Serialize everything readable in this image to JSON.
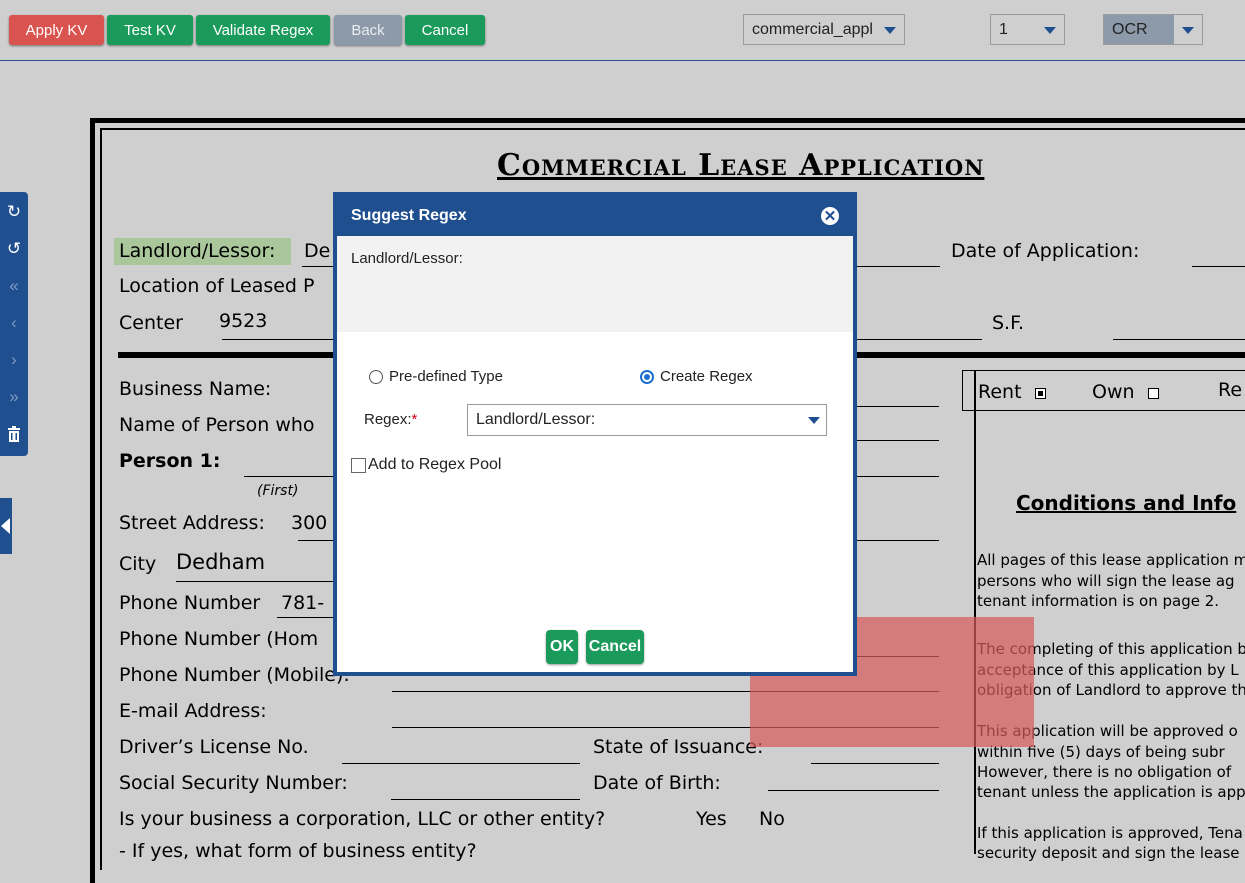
{
  "toolbar": {
    "apply_kv": "Apply KV",
    "test_kv": "Test KV",
    "validate_regex": "Validate Regex",
    "back": "Back",
    "cancel": "Cancel",
    "doc_type_select": "commercial_appl",
    "page_select": "1",
    "mode_select": "OCR"
  },
  "document": {
    "title": "Commercial Lease Application",
    "landlord_label": "Landlord/Lessor:",
    "landlord_value_partial": "De",
    "date_of_application": "Date of Application:",
    "location_label": "Location of Leased P",
    "center_label": "Center",
    "center_value": "9523",
    "sf_label": "S.F.",
    "business_name": "Business Name:",
    "name_of_person": "Name of Person who",
    "person1": "Person 1:",
    "first": "(First)",
    "street_address": "Street Address:",
    "street_value_partial": "300",
    "city": "City",
    "city_value": "Dedham",
    "phone_number": "Phone Number",
    "phone_value_partial": "781-",
    "phone_home_partial": "Phone Number (Hom",
    "phone_mobile_partial": "Phone Number (Mobile):",
    "email": "E-mail Address:",
    "drivers_license": "Driver’s License No.",
    "state_of_issuance": "State of Issuance:",
    "ssn": "Social Security Number:",
    "dob": "Date of Birth:",
    "corporation_q": "Is your business a corporation, LLC or other entity?",
    "yes": "Yes",
    "no": "No",
    "if_yes_partial": "- If yes, what form of business entity?",
    "rent": "Rent",
    "own": "Own",
    "re_partial": "Re",
    "conditions_title": "Conditions and Info",
    "para1": [
      "All pages of this lease application mu",
      "persons who will sign the lease ag",
      "tenant information is on page 2."
    ],
    "para2": [
      "The completing of this application b",
      "acceptance of this application by L",
      "obligation of Landlord to approve the a"
    ],
    "para3": [
      "This application will be approved o",
      "within five (5) days of being subr",
      "However, there is no obligation of",
      "tenant unless the application is approv"
    ],
    "para4": [
      "If this application is approved, Tena",
      "security deposit and sign the lease"
    ]
  },
  "modal": {
    "title": "Suggest Regex",
    "preview_text": "Landlord/Lessor:",
    "option_predefined": "Pre-defined Type",
    "option_create": "Create Regex",
    "selected_option": "create",
    "regex_label": "Regex:",
    "required_mark": "*",
    "regex_value": "Landlord/Lessor:",
    "add_to_pool": "Add to Regex Pool",
    "ok": "OK",
    "cancel": "Cancel"
  },
  "colors": {
    "brand_blue": "#1f4f8f",
    "green": "#1a9a5b",
    "red": "#d9534f"
  }
}
